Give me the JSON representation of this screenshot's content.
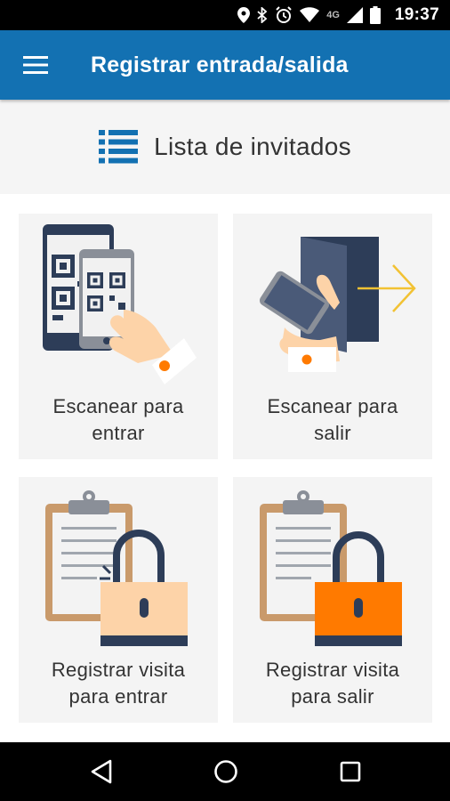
{
  "status_bar": {
    "network": "4G",
    "time": "19:37"
  },
  "app_bar": {
    "title": "Registrar entrada/salida",
    "menu_icon": "hamburger-menu-icon"
  },
  "guest_list": {
    "label": "Lista de invitados",
    "icon": "list-icon"
  },
  "cards": [
    {
      "line1": "Escanear para",
      "line2": "entrar"
    },
    {
      "line1": "Escanear para",
      "line2": "salir"
    },
    {
      "line1": "Registrar visita",
      "line2": "para entrar"
    },
    {
      "line1": "Registrar visita",
      "line2": "para salir"
    }
  ],
  "nav_bar": {
    "back_icon": "back-triangle-icon",
    "home_icon": "home-circle-icon",
    "recents_icon": "recents-square-icon"
  },
  "colors": {
    "app_bar": "#1371b2",
    "accent_orange": "#ff7a00",
    "lock_light": "#fdd3a8",
    "arrow_yellow": "#f2c233",
    "navy": "#2d3d58"
  }
}
